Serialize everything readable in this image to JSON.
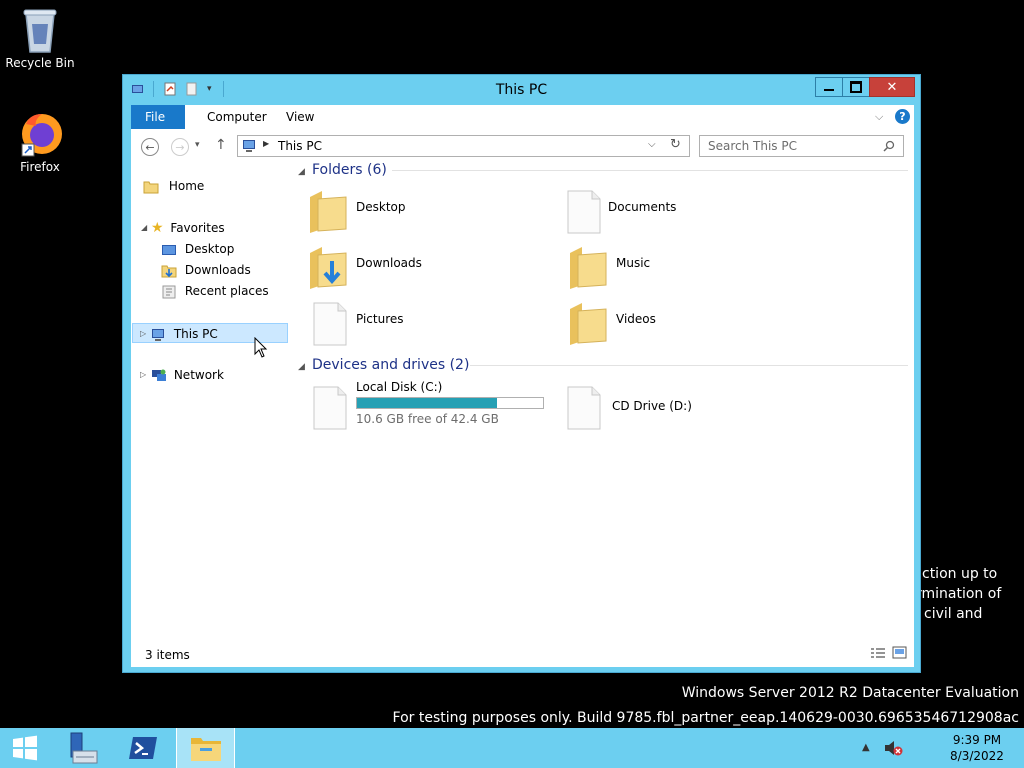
{
  "desktop": {
    "icons": [
      {
        "label": "Recycle Bin",
        "icon": "recycle-bin-icon"
      },
      {
        "label": "Firefox",
        "icon": "firefox-icon"
      }
    ],
    "background_text": [
      "ction up to",
      "rmination of",
      "civil and"
    ],
    "watermark": {
      "line1": "Windows Server 2012 R2 Datacenter Evaluation",
      "line2": "For testing purposes only. Build 9785.fbl_partner_eeap.140629-0030.69653546712908ac"
    }
  },
  "window": {
    "title": "This PC",
    "controls": {
      "minimize": "—",
      "maximize": "□",
      "close": "✕"
    },
    "ribbon_tabs": [
      "File",
      "Computer",
      "View"
    ],
    "address": {
      "path": "This PC"
    },
    "search": {
      "placeholder": "Search This PC"
    },
    "nav": {
      "home": "Home",
      "favorites": "Favorites",
      "favorites_items": [
        "Desktop",
        "Downloads",
        "Recent places"
      ],
      "this_pc": "This PC",
      "network": "Network"
    },
    "folders": {
      "header": "Folders (6)",
      "items": [
        {
          "name": "Desktop",
          "icon": "folder-icon"
        },
        {
          "name": "Documents",
          "icon": "document-icon"
        },
        {
          "name": "Downloads",
          "icon": "downloads-folder-icon"
        },
        {
          "name": "Music",
          "icon": "folder-icon"
        },
        {
          "name": "Pictures",
          "icon": "document-icon"
        },
        {
          "name": "Videos",
          "icon": "folder-icon"
        }
      ]
    },
    "devices": {
      "header": "Devices and drives (2)",
      "items": [
        {
          "name": "Local Disk (C:)",
          "free_text": "10.6 GB free of 42.4 GB",
          "used_fraction": 0.75
        },
        {
          "name": "CD Drive (D:)"
        }
      ]
    },
    "status": {
      "item_count": "3 items"
    }
  },
  "taskbar": {
    "clock": {
      "time": "9:39 PM",
      "date": "8/3/2022"
    },
    "tray_chevron": "▲"
  },
  "colors": {
    "accent": "#6ccff0",
    "file_tab": "#1979ca",
    "drive_bar": "#26a0b4",
    "header_text": "#1e3287"
  }
}
